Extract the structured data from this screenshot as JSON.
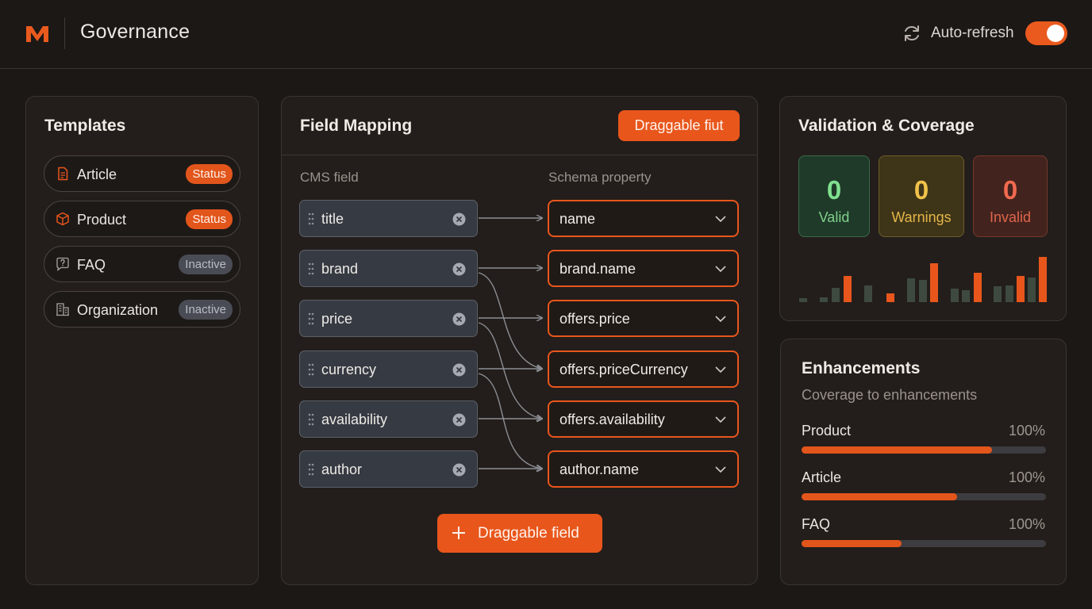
{
  "header": {
    "title": "Governance",
    "auto_refresh_label": "Auto-refresh",
    "auto_refresh_on": true,
    "accent_color": "#ea5a1e"
  },
  "templates": {
    "title": "Templates",
    "items": [
      {
        "label": "Article",
        "badge": "Status",
        "badge_kind": "status",
        "icon": "document-icon"
      },
      {
        "label": "Product",
        "badge": "Status",
        "badge_kind": "status",
        "icon": "cube-icon"
      },
      {
        "label": "FAQ",
        "badge": "Inactive",
        "badge_kind": "inactive",
        "icon": "question-icon"
      },
      {
        "label": "Organization",
        "badge": "Inactive",
        "badge_kind": "inactive",
        "icon": "building-icon"
      }
    ]
  },
  "field_mapping": {
    "title": "Field Mapping",
    "header_button": "Draggable fiut",
    "cms_header": "CMS field",
    "schema_header": "Schema property",
    "cms_fields": [
      "title",
      "brand",
      "price",
      "currency",
      "availability",
      "author"
    ],
    "schema_properties": [
      "name",
      "brand.name",
      "offers.price",
      "offers.priceCurrency",
      "offers.availability",
      "author.name"
    ],
    "add_button": "Draggable field"
  },
  "validation": {
    "title": "Validation & Coverage",
    "stats": [
      {
        "value": "0",
        "label": "Valid",
        "color": "#7fe08f"
      },
      {
        "value": "0",
        "label": "Warnings",
        "color": "#f1c24a"
      },
      {
        "value": "0",
        "label": "Invalid",
        "color": "#f06a4f"
      }
    ],
    "sparkline_colors": {
      "orange": "#e8561c",
      "green": "#3e4a40"
    }
  },
  "enhancements": {
    "title": "Enhancements",
    "subtitle": "Coverage to enhancements",
    "items": [
      {
        "name": "Product",
        "percent_label": "100%",
        "fill": 0.78
      },
      {
        "name": "Article",
        "percent_label": "100%",
        "fill": 0.635
      },
      {
        "name": "FAQ",
        "percent_label": "100%",
        "fill": 0.41
      }
    ]
  }
}
